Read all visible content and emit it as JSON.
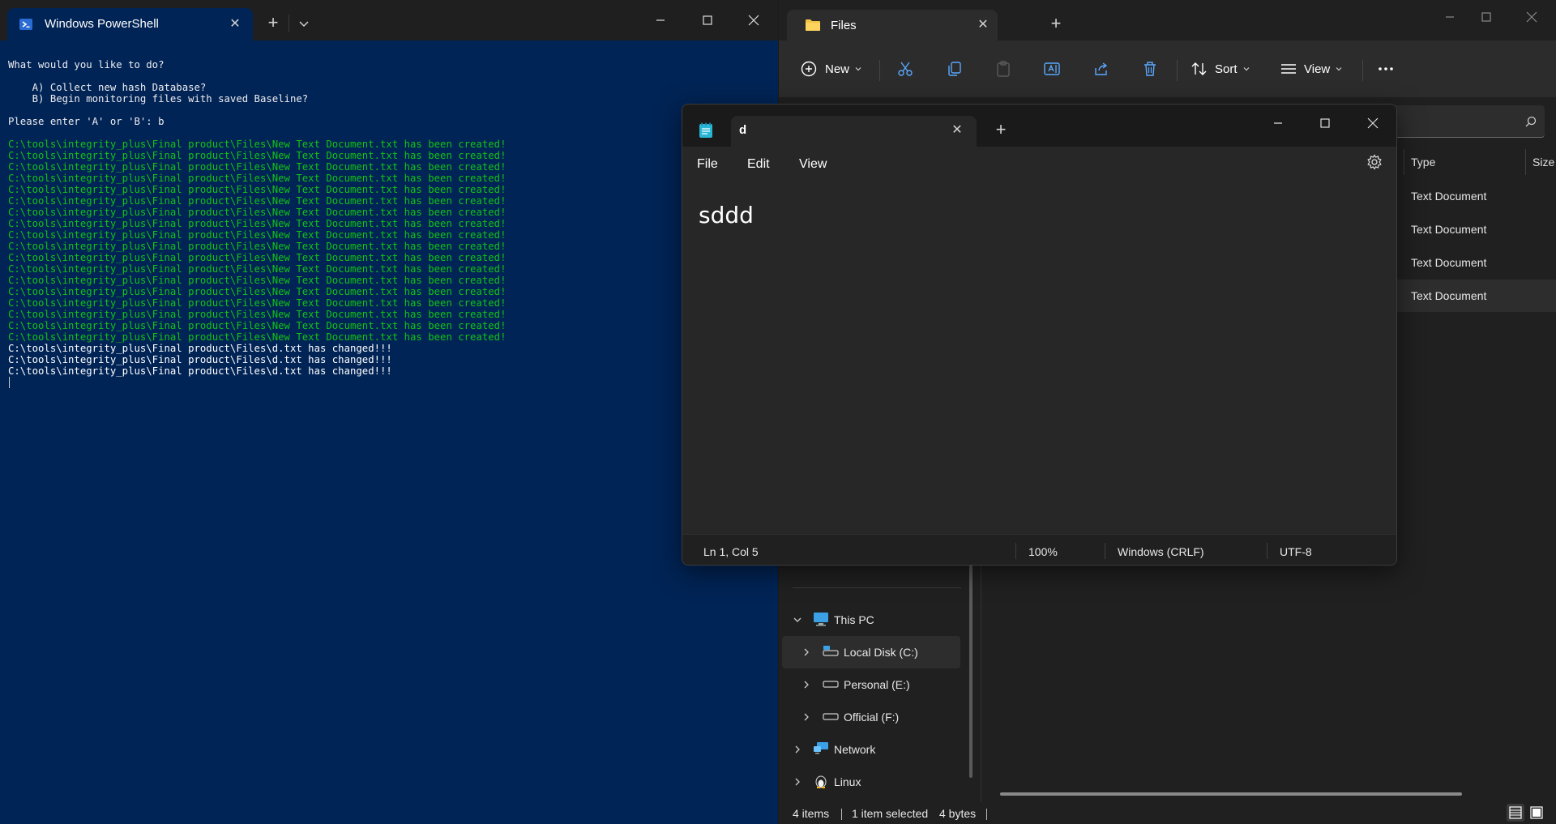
{
  "powershell": {
    "tab_title": "Windows PowerShell",
    "lines": [
      {
        "text": "What would you like to do?",
        "color": "default"
      },
      {
        "text": "",
        "color": "default"
      },
      {
        "text": "    A) Collect new hash Database?",
        "color": "default"
      },
      {
        "text": "    B) Begin monitoring files with saved Baseline?",
        "color": "default"
      },
      {
        "text": "",
        "color": "default"
      },
      {
        "text": "Please enter 'A' or 'B': b",
        "color": "default"
      },
      {
        "text": "",
        "color": "default"
      },
      {
        "text": "C:\\tools\\integrity_plus\\Final product\\Files\\New Text Document.txt has been created!",
        "color": "green"
      },
      {
        "text": "C:\\tools\\integrity_plus\\Final product\\Files\\New Text Document.txt has been created!",
        "color": "green"
      },
      {
        "text": "C:\\tools\\integrity_plus\\Final product\\Files\\New Text Document.txt has been created!",
        "color": "green"
      },
      {
        "text": "C:\\tools\\integrity_plus\\Final product\\Files\\New Text Document.txt has been created!",
        "color": "green"
      },
      {
        "text": "C:\\tools\\integrity_plus\\Final product\\Files\\New Text Document.txt has been created!",
        "color": "green"
      },
      {
        "text": "C:\\tools\\integrity_plus\\Final product\\Files\\New Text Document.txt has been created!",
        "color": "green"
      },
      {
        "text": "C:\\tools\\integrity_plus\\Final product\\Files\\New Text Document.txt has been created!",
        "color": "green"
      },
      {
        "text": "C:\\tools\\integrity_plus\\Final product\\Files\\New Text Document.txt has been created!",
        "color": "green"
      },
      {
        "text": "C:\\tools\\integrity_plus\\Final product\\Files\\New Text Document.txt has been created!",
        "color": "green"
      },
      {
        "text": "C:\\tools\\integrity_plus\\Final product\\Files\\New Text Document.txt has been created!",
        "color": "green"
      },
      {
        "text": "C:\\tools\\integrity_plus\\Final product\\Files\\New Text Document.txt has been created!",
        "color": "green"
      },
      {
        "text": "C:\\tools\\integrity_plus\\Final product\\Files\\New Text Document.txt has been created!",
        "color": "green"
      },
      {
        "text": "C:\\tools\\integrity_plus\\Final product\\Files\\New Text Document.txt has been created!",
        "color": "green"
      },
      {
        "text": "C:\\tools\\integrity_plus\\Final product\\Files\\New Text Document.txt has been created!",
        "color": "green"
      },
      {
        "text": "C:\\tools\\integrity_plus\\Final product\\Files\\New Text Document.txt has been created!",
        "color": "green"
      },
      {
        "text": "C:\\tools\\integrity_plus\\Final product\\Files\\New Text Document.txt has been created!",
        "color": "green"
      },
      {
        "text": "C:\\tools\\integrity_plus\\Final product\\Files\\New Text Document.txt has been created!",
        "color": "green"
      },
      {
        "text": "C:\\tools\\integrity_plus\\Final product\\Files\\New Text Document.txt has been created!",
        "color": "green"
      },
      {
        "text": "C:\\tools\\integrity_plus\\Final product\\Files\\d.txt has changed!!!",
        "color": "white"
      },
      {
        "text": "C:\\tools\\integrity_plus\\Final product\\Files\\d.txt has changed!!!",
        "color": "white"
      },
      {
        "text": "C:\\tools\\integrity_plus\\Final product\\Files\\d.txt has changed!!!",
        "color": "white"
      }
    ],
    "colors": {
      "background": "#012456",
      "green": "#13c313",
      "text": "#eeedf0"
    }
  },
  "files": {
    "tab_title": "Files",
    "toolbar": {
      "new_label": "New",
      "sort_label": "Sort",
      "view_label": "View"
    },
    "columns": {
      "type": "Type",
      "size": "Size"
    },
    "rows": [
      {
        "type": "Text Document",
        "selected": false
      },
      {
        "type": "Text Document",
        "selected": false
      },
      {
        "type": "Text Document",
        "selected": false
      },
      {
        "type": "Text Document",
        "selected": true
      }
    ],
    "sidebar": {
      "this_pc": "This PC",
      "local_disk": "Local Disk (C:)",
      "personal": "Personal (E:)",
      "official": "Official (F:)",
      "network": "Network",
      "linux": "Linux"
    },
    "status": {
      "items": "4 items",
      "selected": "1 item selected",
      "size": "4 bytes"
    }
  },
  "notepad": {
    "tab_title": "d",
    "menus": {
      "file": "File",
      "edit": "Edit",
      "view": "View"
    },
    "content": "sddd",
    "status": {
      "position": "Ln 1, Col 5",
      "zoom": "100%",
      "line_ending": "Windows (CRLF)",
      "encoding": "UTF-8"
    }
  }
}
